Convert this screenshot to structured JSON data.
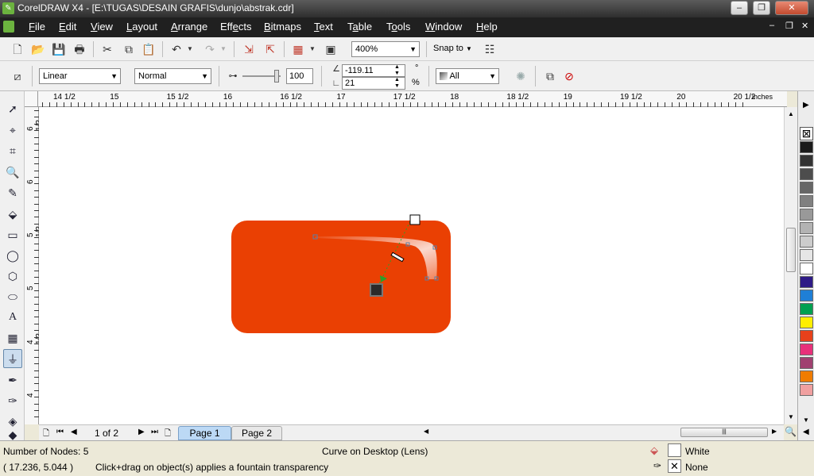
{
  "window": {
    "title": "CorelDRAW X4 - [E:\\TUGAS\\DESAIN GRAFIS\\dunjo\\abstrak.cdr]"
  },
  "menu": [
    {
      "label": "File",
      "u": "F",
      "rest": "ile"
    },
    {
      "label": "Edit",
      "u": "E",
      "rest": "dit"
    },
    {
      "label": "View",
      "u": "V",
      "rest": "iew"
    },
    {
      "label": "Layout",
      "u": "L",
      "rest": "ayout"
    },
    {
      "label": "Arrange",
      "u": "A",
      "rest": "rrange"
    },
    {
      "label": "Effects",
      "pre": "Eff",
      "u": "e",
      "rest": "cts"
    },
    {
      "label": "Bitmaps",
      "u": "B",
      "rest": "itmaps"
    },
    {
      "label": "Text",
      "u": "T",
      "rest": "ext"
    },
    {
      "label": "Table",
      "pre": "T",
      "u": "a",
      "rest": "ble"
    },
    {
      "label": "Tools",
      "pre": "T",
      "u": "o",
      "rest": "ols"
    },
    {
      "label": "Window",
      "u": "W",
      "rest": "indow"
    },
    {
      "label": "Help",
      "u": "H",
      "rest": "elp"
    }
  ],
  "standard_toolbar": {
    "zoom_level": "400%",
    "snap_to": "Snap to"
  },
  "property_bar": {
    "transparency_type": "Linear",
    "merge_mode": "Normal",
    "opacity_value": "100",
    "angle": "-119.11",
    "angle_unit": "°",
    "edge_pad": "21",
    "edge_unit": "%",
    "apply_target": "All"
  },
  "ruler": {
    "units": "inches",
    "h_labels": [
      "14 1/2",
      "15",
      "15 1/2",
      "16",
      "16 1/2",
      "17",
      "17 1/2",
      "18",
      "18 1/2",
      "19",
      "19 1/2",
      "20",
      "20 1/2"
    ],
    "v_labels": [
      "6 1/2",
      "6",
      "5 1/2",
      "5",
      "4 1/2",
      "4"
    ]
  },
  "pages": {
    "counter": "1 of 2",
    "tabs": [
      "Page 1",
      "Page 2"
    ],
    "active": "Page 1"
  },
  "status": {
    "nodes": "Number of Nodes: 5",
    "object_info": "Curve on Desktop  (Lens)",
    "coords": "( 17.236, 5.044 )",
    "hint": "Click+drag on object(s) applies a fountain transparency",
    "fill_name": "White",
    "outline_name": "None"
  },
  "colors": {
    "shape_fill": "#ea4003",
    "palette": [
      "#ffffff",
      "#1a1a1a",
      "#333333",
      "#4d4d4d",
      "#666666",
      "#808080",
      "#999999",
      "#b3b3b3",
      "#cccccc",
      "#e6e6e6",
      "#ffffff",
      "#2e1a86",
      "#1f7fd6",
      "#00a050",
      "#ffee00",
      "#e8411b",
      "#e8307a",
      "#a04070",
      "#f07c00",
      "#f0a0a0"
    ]
  }
}
